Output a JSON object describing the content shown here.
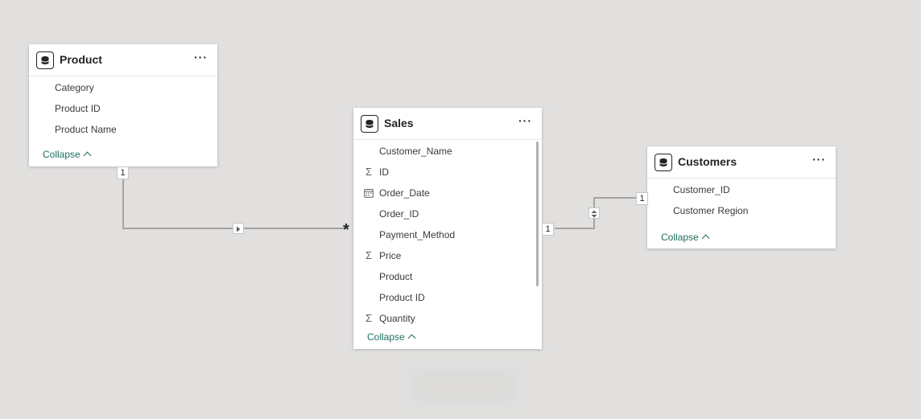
{
  "tables": {
    "product": {
      "title": "Product",
      "more": "···",
      "fields": [
        "Category",
        "Product ID",
        "Product Name"
      ],
      "collapse": "Collapse"
    },
    "sales": {
      "title": "Sales",
      "more": "···",
      "fields": [
        {
          "label": "Customer_Name",
          "icon": ""
        },
        {
          "label": "ID",
          "icon": "Σ"
        },
        {
          "label": "Order_Date",
          "icon": "calendar"
        },
        {
          "label": "Order_ID",
          "icon": ""
        },
        {
          "label": "Payment_Method",
          "icon": ""
        },
        {
          "label": "Price",
          "icon": "Σ"
        },
        {
          "label": "Product",
          "icon": ""
        },
        {
          "label": "Product ID",
          "icon": ""
        },
        {
          "label": "Quantity",
          "icon": "Σ"
        }
      ],
      "collapse": "Collapse"
    },
    "customers": {
      "title": "Customers",
      "more": "···",
      "fields": [
        "Customer_ID",
        "Customer Region"
      ],
      "collapse": "Collapse"
    }
  },
  "relationships": {
    "product_sales": {
      "from_card": "1",
      "to_card": "*"
    },
    "sales_customers": {
      "from_card": "1",
      "to_card": "1"
    }
  },
  "colors": {
    "canvas": "#e1e0df",
    "accent": "#1d6f5f",
    "connector": "#a4a3a2"
  }
}
